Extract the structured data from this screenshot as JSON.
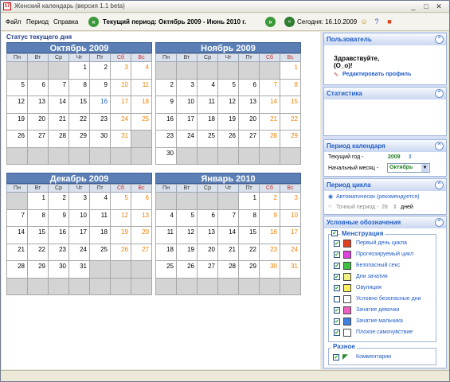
{
  "window": {
    "title": "Женский календарь (версия 1.1 beta)",
    "app_icon": "17",
    "controls": [
      "_",
      "□",
      "✕"
    ]
  },
  "menu": {
    "items": [
      "Файл",
      "Период",
      "Справка"
    ]
  },
  "toolbar": {
    "prev_icon": "«",
    "next_icon": "»",
    "period": "Текущий период: Октябрь 2009 - Июнь 2010 г.",
    "today_icon": "»",
    "today": "Сегодня: 16.10.2009"
  },
  "main": {
    "status_title": "Статус текущего дня",
    "weekdays": [
      "Пн",
      "Вт",
      "Ср",
      "Чт",
      "Пт",
      "Сб",
      "Вс"
    ],
    "calendars": [
      {
        "title": "Октябрь 2009",
        "start": 3,
        "days": 31,
        "today": 16
      },
      {
        "title": "Ноябрь 2009",
        "start": 6,
        "days": 30,
        "today": 0
      },
      {
        "title": "Декабрь 2009",
        "start": 1,
        "days": 31,
        "today": 0
      },
      {
        "title": "Январь 2010",
        "start": 4,
        "days": 31,
        "today": 0
      }
    ]
  },
  "side": {
    "user": {
      "title": "Пользователь",
      "greeting": "Здравствуйте,",
      "name": "(O_o)!",
      "edit": "Редактировать профиль"
    },
    "stats": {
      "title": "Статистика"
    },
    "cal_period": {
      "title": "Период календаря",
      "year_label": "Текущий год -",
      "year_value": "2009",
      "month_label": "Начальный месяц -",
      "month_value": "Октябрь"
    },
    "cycle": {
      "title": "Период цикла",
      "auto": "Автоматически (рекомендуется)",
      "exact_label": "Точный период -",
      "exact_value": "28",
      "days": "дней"
    },
    "legend": {
      "title": "Условные обозначения",
      "group1": "Менструация",
      "items": [
        {
          "label": "Первый день цикла",
          "color": "#e04020",
          "checked": true
        },
        {
          "label": "Прогнозируемый цикл",
          "color": "#e040e0",
          "checked": true
        },
        {
          "label": "Безопасный секс",
          "color": "#40c040",
          "checked": true
        },
        {
          "label": "Дни зачатия",
          "color": "#f0f080",
          "checked": true
        },
        {
          "label": "Овуляция",
          "color": "#f8f060",
          "checked": true
        },
        {
          "label": "Условно безопасные дни",
          "color": "#ffffff",
          "checked": false
        },
        {
          "label": "Зачатие девочки",
          "color": "#f060c0",
          "checked": true
        },
        {
          "label": "Зачатие мальчика",
          "color": "#4080e0",
          "checked": true
        },
        {
          "label": "Плохое самочувствие",
          "color": "#ffffff",
          "checked": true
        }
      ],
      "group2": "Разное",
      "comments": "Комментарии"
    }
  }
}
